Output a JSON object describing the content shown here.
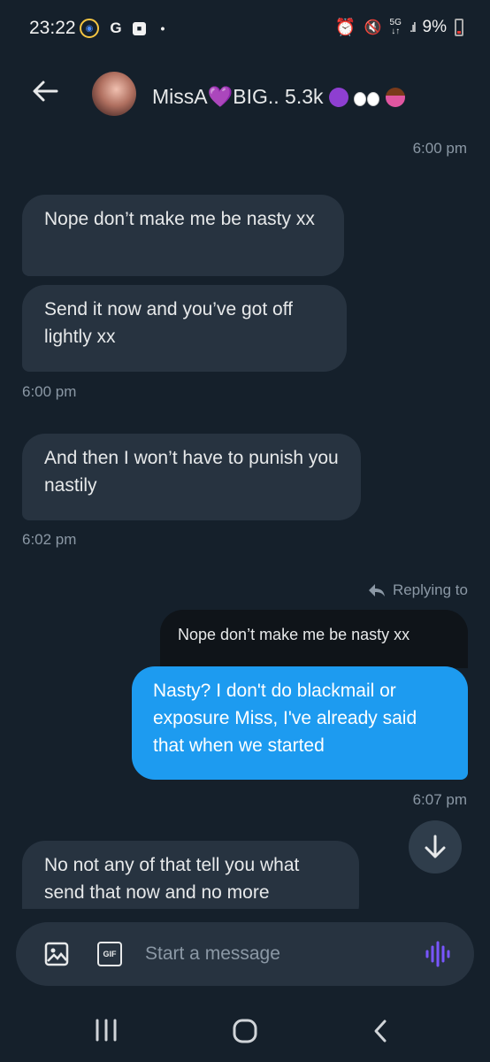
{
  "status": {
    "time": "23:22",
    "left_icons": [
      "location-icon",
      "google-icon",
      "app-icon",
      "dot-icon"
    ],
    "network": "5G",
    "battery": "9%"
  },
  "header": {
    "contact_name": "MissA💜BIG.. 5.3k",
    "contact_name_emojis": [
      "purple-heart",
      "smiling-imp",
      "eyes",
      "woman-shrugging"
    ]
  },
  "messages": [
    {
      "type": "timestamp",
      "text": "6:00 pm"
    },
    {
      "type": "received",
      "text": "Nope don’t make me be nasty xx"
    },
    {
      "type": "received",
      "text": "Send it now and you’ve got off lightly xx"
    },
    {
      "type": "timestamp",
      "text": "6:00 pm"
    },
    {
      "type": "received",
      "text": "And then I won’t have to punish you nastily"
    },
    {
      "type": "timestamp",
      "text": "6:02 pm"
    },
    {
      "type": "reply_indicator",
      "text": "Replying to"
    },
    {
      "type": "quoted",
      "text": "Nope don’t make me be nasty xx"
    },
    {
      "type": "sent",
      "text": "Nasty? I don't do blackmail or exposure Miss, I've already said that when we started"
    },
    {
      "type": "timestamp",
      "text": "6:07 pm"
    },
    {
      "type": "received",
      "text": "No not any of that tell you what send that now and no more"
    }
  ],
  "composer": {
    "placeholder": "Start a message",
    "gif_label": "GIF"
  },
  "colors": {
    "background": "#15202b",
    "received_bubble": "#273340",
    "sent_bubble": "#1d9bf0",
    "accent_voice": "#7856ff"
  }
}
